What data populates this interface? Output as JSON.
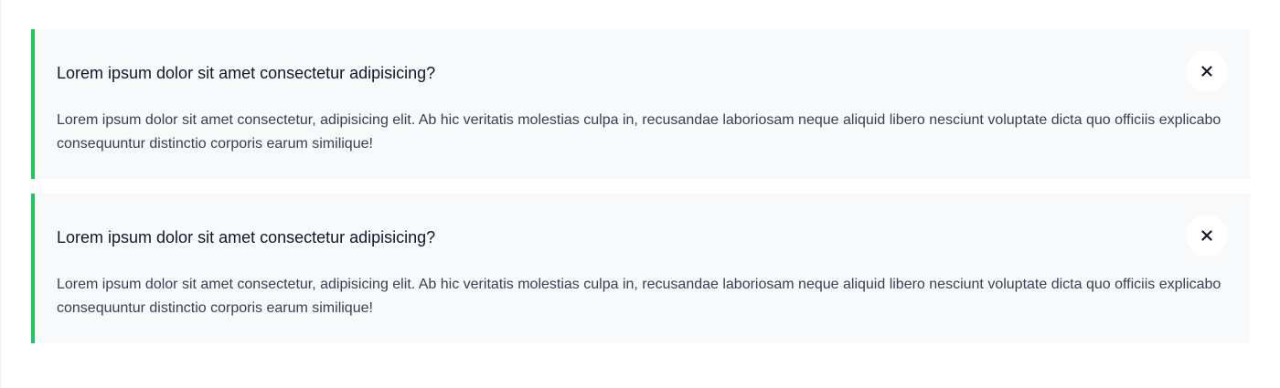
{
  "colors": {
    "accent": "#22c55e",
    "card_background": "#f8f9fb",
    "question_text": "#111827",
    "answer_text": "#374151"
  },
  "faq": {
    "items": [
      {
        "question": "Lorem ipsum dolor sit amet consectetur adipisicing?",
        "answer": "Lorem ipsum dolor sit amet consectetur, adipisicing elit. Ab hic veritatis molestias culpa in, recusandae laboriosam neque aliquid libero nesciunt voluptate dicta quo officiis explicabo consequuntur distinctio corporis earum similique!",
        "close_icon": "close-icon",
        "expanded": true
      },
      {
        "question": "Lorem ipsum dolor sit amet consectetur adipisicing?",
        "answer": "Lorem ipsum dolor sit amet consectetur, adipisicing elit. Ab hic veritatis molestias culpa in, recusandae laboriosam neque aliquid libero nesciunt voluptate dicta quo officiis explicabo consequuntur distinctio corporis earum similique!",
        "close_icon": "close-icon",
        "expanded": true
      }
    ]
  }
}
